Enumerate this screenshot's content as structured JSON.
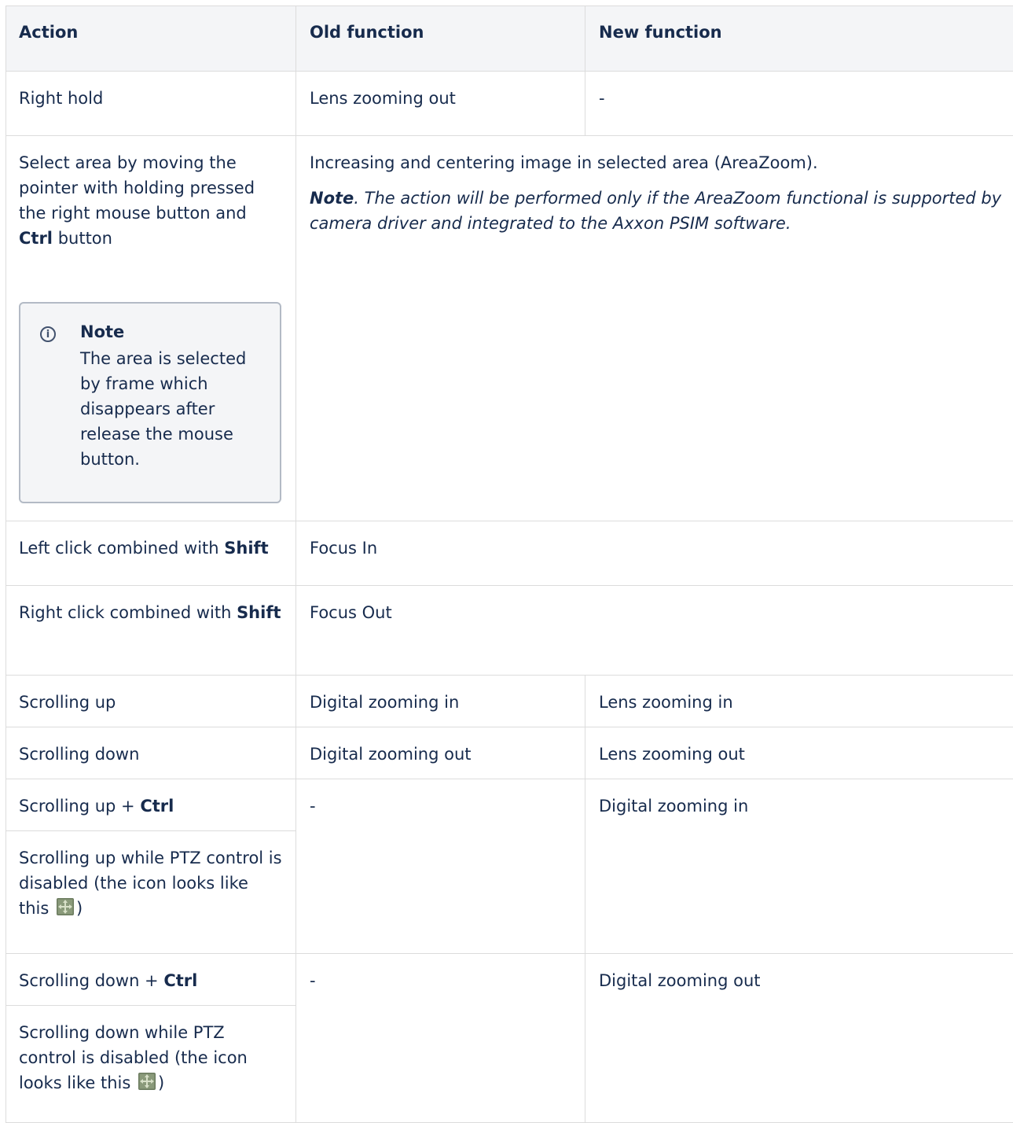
{
  "headers": {
    "action": "Action",
    "old": "Old function",
    "new": "New function"
  },
  "r1": {
    "action": "Right hold",
    "old": "Lens zooming out",
    "new": "-"
  },
  "r2": {
    "action_pre": "Select area by moving the pointer with holding pressed the right mouse button and ",
    "action_bold": "Ctrl",
    "action_post": " button",
    "merged": "Increasing and centering image in selected area (AreaZoom).",
    "note_bold": "Note",
    "note_rest": ". The action will be performed only if the AreaZoom functional is supported by camera driver and integrated to the Axxon PSIM software.",
    "note_title": "Note",
    "note_body": "The area is selected by frame which disappears after release the mouse button."
  },
  "r3": {
    "action_pre": "Left click combined with ",
    "action_bold": "Shift",
    "merged": "Focus In"
  },
  "r4": {
    "action_pre": "Right click combined with ",
    "action_bold": "Shift",
    "merged": "Focus Out"
  },
  "r5": {
    "action": "Scrolling up",
    "old": "Digital zooming in",
    "new": "Lens zooming in"
  },
  "r6": {
    "action": "Scrolling down",
    "old": "Digital zooming out",
    "new": "Lens zooming out"
  },
  "r7": {
    "action_pre": "Scrolling up + ",
    "action_bold": "Ctrl",
    "action2_pre": "Scrolling up while PTZ control is disabled (the icon looks like this ",
    "action2_post": ")",
    "old": "-",
    "new": "Digital zooming in"
  },
  "r8": {
    "action_pre": "Scrolling down + ",
    "action_bold": "Ctrl",
    "action2_pre": "Scrolling down while PTZ control is disabled (the icon looks like this ",
    "action2_post": ")",
    "old": "-",
    "new": "Digital zooming out"
  },
  "icons": {
    "note": "info-icon",
    "ptz": "ptz-move-icon"
  }
}
